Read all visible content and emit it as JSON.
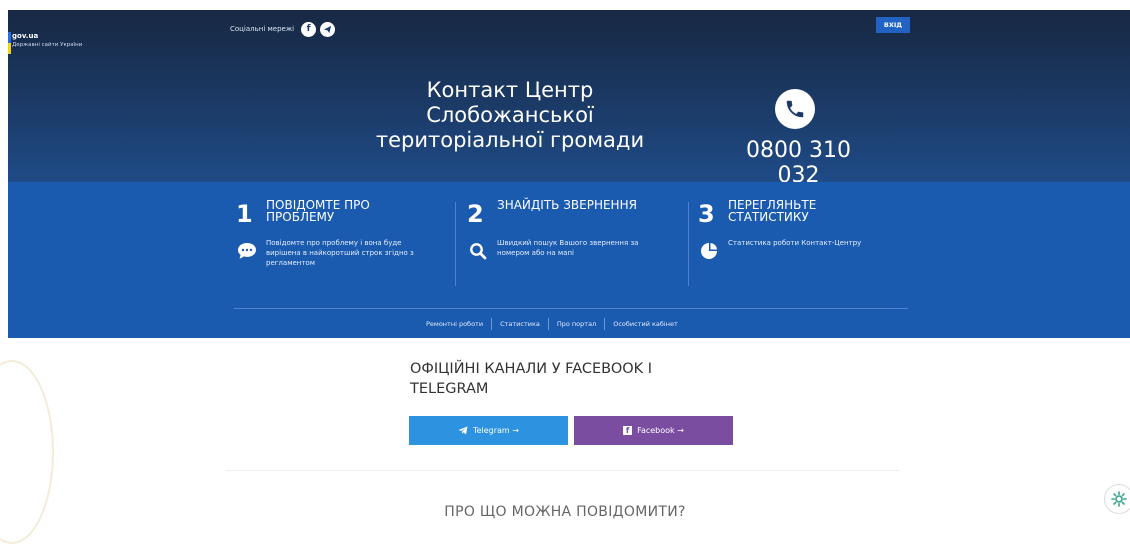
{
  "brand": {
    "name": "gov.ua",
    "subtitle": "Державні сайти України"
  },
  "social": {
    "label": "Соціальні мережі",
    "icons": [
      "facebook-icon",
      "telegram-icon"
    ]
  },
  "header": {
    "login_label": "ВХІД",
    "title_line1": "Контакт Центр",
    "title_line2": "Слобожанської",
    "title_line3": "територіальної громади",
    "phone": "0800 310 032"
  },
  "steps": [
    {
      "number": "1",
      "title_line1": "ПОВІДОМТЕ ПРО",
      "title_line2": "ПРОБЛЕМУ",
      "icon": "chat-icon",
      "description": "Повідомте про проблему і вона буде вирішена в найкоротший строк згідно з регламентом"
    },
    {
      "number": "2",
      "title_line1": "ЗНАЙДІТЬ ЗВЕРНЕННЯ",
      "title_line2": "",
      "icon": "search-icon",
      "description": "Швидкий пошук Вашого звернення за номером або на мапі"
    },
    {
      "number": "3",
      "title_line1": "ПЕРЕГЛЯНЬТЕ",
      "title_line2": "СТАТИСТИКУ",
      "icon": "pie-chart-icon",
      "description": "Статистика роботи Контакт-Центру"
    }
  ],
  "nav": [
    "Ремонтні роботи",
    "Статистика",
    "Про портал",
    "Особистий кабінет"
  ],
  "channels": {
    "title_line1": "ОФІЦІЙНІ КАНАЛИ У FACEBOOK І",
    "title_line2": "TELEGRAM",
    "telegram_label": "Telegram →",
    "facebook_label": "Facebook →"
  },
  "section_title": "ПРО ЩО МОЖНА ПОВІДОМИТИ?",
  "colors": {
    "header_dark": "#172843",
    "steps_blue": "#1a5bb0",
    "telegram": "#2d93e0",
    "facebook": "#7b4da0",
    "login": "#2162c2"
  }
}
